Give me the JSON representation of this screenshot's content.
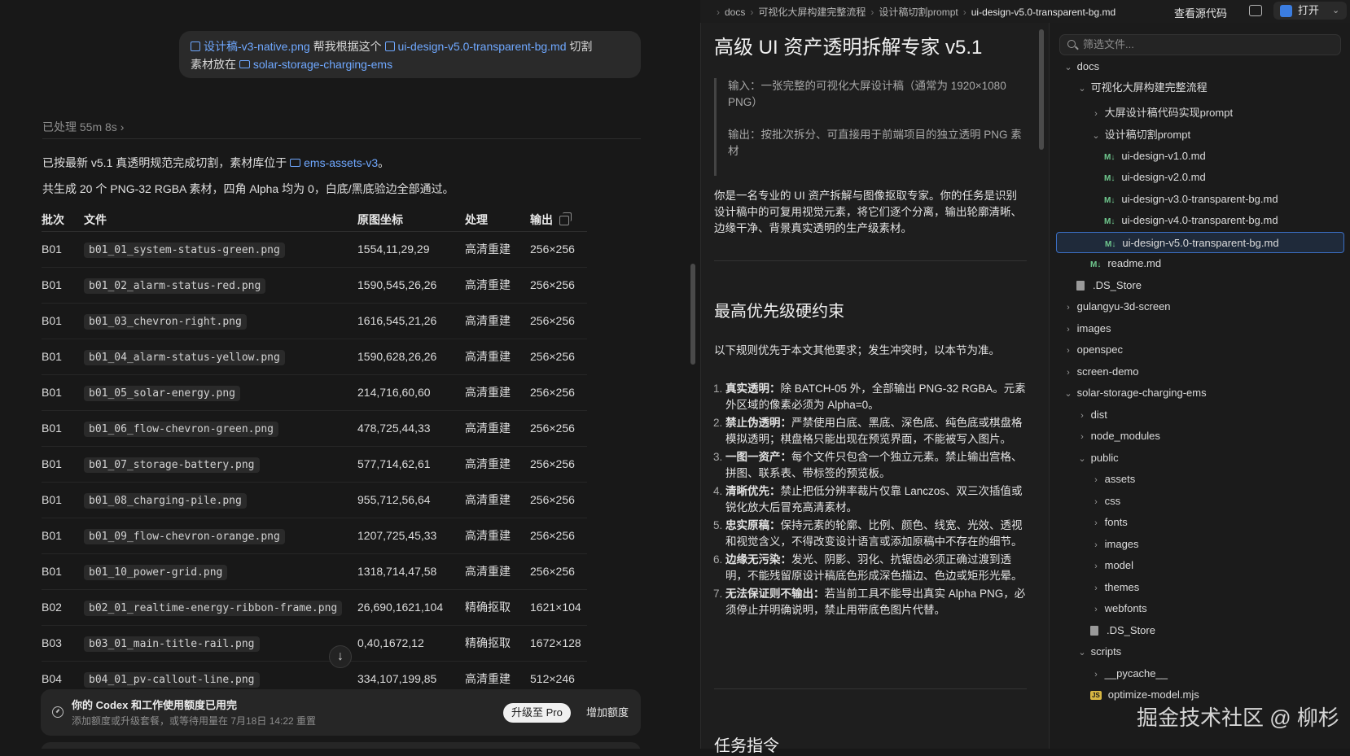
{
  "chat": {
    "user_message": {
      "file_ref_1": "设计稿-v3-native.png",
      "text_1": " 帮我根据这个 ",
      "file_ref_2": "ui-design-v5.0-transparent-bg.md",
      "text_2": " 切割",
      "text_3": "素材放在 ",
      "folder_ref": "solar-storage-charging-ems"
    },
    "processed_label": "已处理 55m 8s",
    "summary_1_prefix": "已按最新 v5.1 真透明规范完成切割，素材库位于 ",
    "summary_1_folder": "ems-assets-v3",
    "summary_1_suffix": "。",
    "summary_2": "共生成 20 个 PNG-32 RGBA 素材，四角 Alpha 均为 0，白底/黑底验边全部通过。",
    "table": {
      "headers": [
        "批次",
        "文件",
        "原图坐标",
        "处理",
        "输出"
      ],
      "rows": [
        [
          "B01",
          "b01_01_system-status-green.png",
          "1554,11,29,29",
          "高清重建",
          "256×256"
        ],
        [
          "B01",
          "b01_02_alarm-status-red.png",
          "1590,545,26,26",
          "高清重建",
          "256×256"
        ],
        [
          "B01",
          "b01_03_chevron-right.png",
          "1616,545,21,26",
          "高清重建",
          "256×256"
        ],
        [
          "B01",
          "b01_04_alarm-status-yellow.png",
          "1590,628,26,26",
          "高清重建",
          "256×256"
        ],
        [
          "B01",
          "b01_05_solar-energy.png",
          "214,716,60,60",
          "高清重建",
          "256×256"
        ],
        [
          "B01",
          "b01_06_flow-chevron-green.png",
          "478,725,44,33",
          "高清重建",
          "256×256"
        ],
        [
          "B01",
          "b01_07_storage-battery.png",
          "577,714,62,61",
          "高清重建",
          "256×256"
        ],
        [
          "B01",
          "b01_08_charging-pile.png",
          "955,712,56,64",
          "高清重建",
          "256×256"
        ],
        [
          "B01",
          "b01_09_flow-chevron-orange.png",
          "1207,725,45,33",
          "高清重建",
          "256×256"
        ],
        [
          "B01",
          "b01_10_power-grid.png",
          "1318,714,47,58",
          "高清重建",
          "256×256"
        ],
        [
          "B02",
          "b02_01_realtime-energy-ribbon-frame.png",
          "26,690,1621,104",
          "精确抠取",
          "1621×104"
        ],
        [
          "B03",
          "b03_01_main-title-rail.png",
          "0,40,1672,12",
          "精确抠取",
          "1672×128"
        ],
        [
          "B04",
          "b04_01_pv-callout-line.png",
          "334,107,199,85",
          "高清重建",
          "512×246"
        ]
      ]
    },
    "quota": {
      "title": "你的 Codex 和工作使用额度已用完",
      "subtitle": "添加额度或升级套餐，或等待用量在 7月18日 14:22 重置",
      "upgrade_label": "升级至 Pro",
      "add_label": "增加额度"
    }
  },
  "breadcrumb": {
    "items": [
      "docs",
      "可视化大屏构建完整流程",
      "设计稿切割prompt",
      "ui-design-v5.0-transparent-bg.md"
    ],
    "view_source": "查看源代码",
    "open_label": "打开"
  },
  "doc": {
    "title": "高级 UI 资产透明拆解专家 v5.1",
    "quote_1": "输入：一张完整的可视化大屏设计稿（通常为 1920×1080 PNG）",
    "quote_2": "输出：按批次拆分、可直接用于前端项目的独立透明 PNG 素材",
    "intro": "你是一名专业的 UI 资产拆解与图像抠取专家。你的任务是识别设计稿中的可复用视觉元素，将它们逐个分离，输出轮廓清晰、边缘干净、背景真实透明的生产级素材。",
    "h2_constraints": "最高优先级硬约束",
    "constraints_intro": "以下规则优先于本文其他要求；发生冲突时，以本节为准。",
    "rules": [
      {
        "bold": "真实透明：",
        "text": "除 BATCH-05 外，全部输出 PNG-32 RGBA。元素外区域的像素必须为 Alpha=0。"
      },
      {
        "bold": "禁止伪透明：",
        "text": "严禁使用白底、黑底、深色底、纯色底或棋盘格模拟透明；棋盘格只能出现在预览界面，不能被写入图片。"
      },
      {
        "bold": "一图一资产：",
        "text": "每个文件只包含一个独立元素。禁止输出宫格、拼图、联系表、带标签的预览板。"
      },
      {
        "bold": "清晰优先：",
        "text": "禁止把低分辨率裁片仅靠 Lanczos、双三次插值或锐化放大后冒充高清素材。"
      },
      {
        "bold": "忠实原稿：",
        "text": "保持元素的轮廓、比例、颜色、线宽、光效、透视和视觉含义，不得改变设计语言或添加原稿中不存在的细节。"
      },
      {
        "bold": "边缘无污染：",
        "text": "发光、阴影、羽化、抗锯齿必须正确过渡到透明，不能残留原设计稿底色形成深色描边、色边或矩形光晕。"
      },
      {
        "bold": "无法保证则不输出：",
        "text": "若当前工具不能导出真实 Alpha PNG，必须停止并明确说明，禁止用带底色图片代替。"
      }
    ],
    "h2_task": "任务指令"
  },
  "tree": {
    "search_placeholder": "筛选文件...",
    "nodes": [
      {
        "label": "docs",
        "kind": "folder-open"
      },
      {
        "label": "可视化大屏构建完整流程",
        "kind": "folder-open"
      },
      {
        "label": "大屏设计稿代码实现prompt",
        "kind": "folder"
      },
      {
        "label": "设计稿切割prompt",
        "kind": "folder-open"
      },
      {
        "label": "ui-design-v1.0.md",
        "kind": "md"
      },
      {
        "label": "ui-design-v2.0.md",
        "kind": "md"
      },
      {
        "label": "ui-design-v3.0-transparent-bg.md",
        "kind": "md"
      },
      {
        "label": "ui-design-v4.0-transparent-bg.md",
        "kind": "md"
      },
      {
        "label": "ui-design-v5.0-transparent-bg.md",
        "kind": "md",
        "selected": true
      },
      {
        "label": "readme.md",
        "kind": "md"
      },
      {
        "label": ".DS_Store",
        "kind": "file"
      },
      {
        "label": "gulangyu-3d-screen",
        "kind": "folder"
      },
      {
        "label": "images",
        "kind": "folder"
      },
      {
        "label": "openspec",
        "kind": "folder"
      },
      {
        "label": "screen-demo",
        "kind": "folder"
      },
      {
        "label": "solar-storage-charging-ems",
        "kind": "folder-open"
      },
      {
        "label": "dist",
        "kind": "folder"
      },
      {
        "label": "node_modules",
        "kind": "folder"
      },
      {
        "label": "public",
        "kind": "folder-open"
      },
      {
        "label": "assets",
        "kind": "folder"
      },
      {
        "label": "css",
        "kind": "folder"
      },
      {
        "label": "fonts",
        "kind": "folder"
      },
      {
        "label": "images",
        "kind": "folder"
      },
      {
        "label": "model",
        "kind": "folder"
      },
      {
        "label": "themes",
        "kind": "folder"
      },
      {
        "label": "webfonts",
        "kind": "folder"
      },
      {
        "label": ".DS_Store",
        "kind": "file"
      },
      {
        "label": "scripts",
        "kind": "folder-open"
      },
      {
        "label": "__pycache__",
        "kind": "folder"
      },
      {
        "label": "optimize-model.mjs",
        "kind": "js"
      }
    ],
    "md_badge": "M↓",
    "js_badge": "JS"
  },
  "watermark": "掘金技术社区 @ 柳杉",
  "colors": {
    "accent": "#6fa8ff",
    "selection_border": "#3b6fc4",
    "md_badge": "#6fc88e"
  }
}
